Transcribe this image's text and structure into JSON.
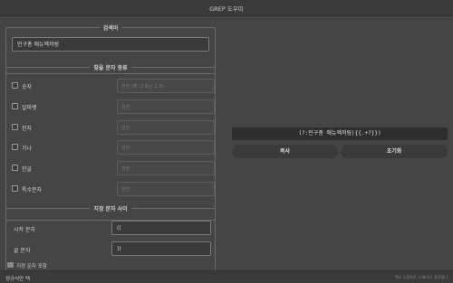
{
  "window": {
    "title": "GREP 도우미"
  },
  "search_group": {
    "legend": "검색어",
    "value": "인구총 애뉴엑저링"
  },
  "char_type_group": {
    "legend": "찾을 문자 종류",
    "items": [
      {
        "label": "숫자",
        "placeholder": "빈칸 (예: 3 또는 2,3)"
      },
      {
        "label": "알파벳",
        "placeholder": "빈칸"
      },
      {
        "label": "한자",
        "placeholder": "빈칸"
      },
      {
        "label": "가나",
        "placeholder": "빈칸"
      },
      {
        "label": "한글",
        "placeholder": "빈칸"
      },
      {
        "label": "특수문자",
        "placeholder": "빈칸"
      }
    ]
  },
  "delim_group": {
    "legend": "지정 문자 사이",
    "start_label": "시작 문자",
    "start_value": "((",
    "end_label": "끝 문자",
    "end_value": "))",
    "include_label": "지정 문자 포함"
  },
  "result": {
    "pattern": "(?:인구총 애뉴엑저링|{{.+?}})"
  },
  "buttons": {
    "copy": "복사",
    "reset": "초기화"
  },
  "status": {
    "left": "정규식만 텍",
    "right": "텍스 도움하기, 노재라고, 종료합니"
  }
}
